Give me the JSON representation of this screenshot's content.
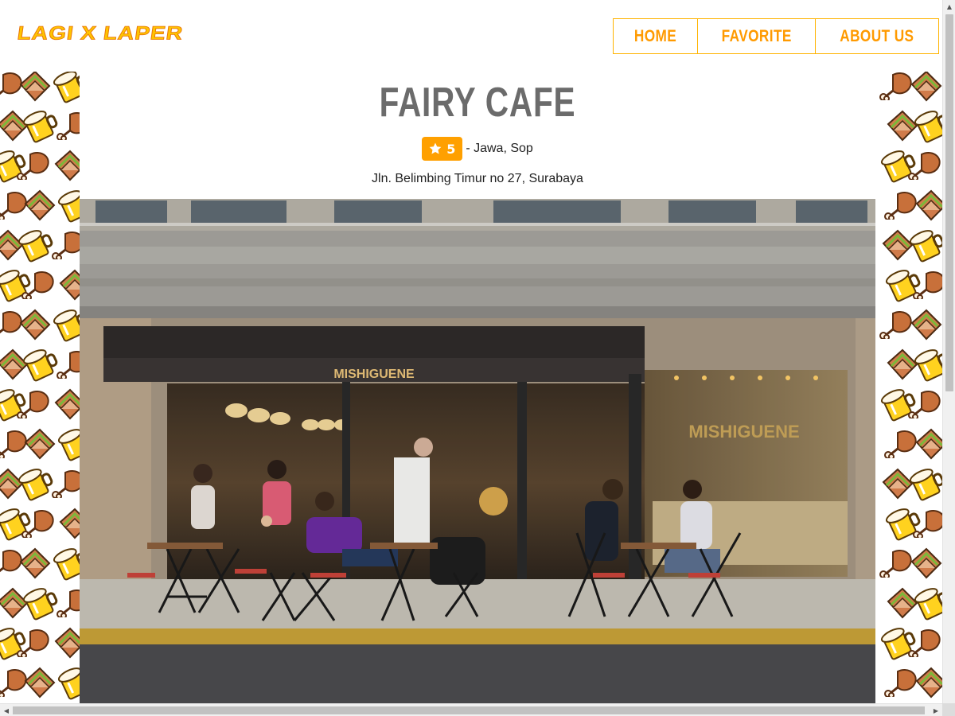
{
  "brand": {
    "logo_text": "LAGI X LAPER"
  },
  "nav": {
    "items": [
      {
        "label": "HOME"
      },
      {
        "label": "FAVORITE"
      },
      {
        "label": "ABOUT US"
      }
    ]
  },
  "restaurant": {
    "name": "FAIRY CAFE",
    "rating": "5",
    "categories": "- Jawa, Sop",
    "address": "Jln. Belimbing Timur no 27, Surabaya",
    "photo_sign_text": "MISHIGUENE"
  },
  "icons": {
    "rating": "star-icon",
    "pattern": [
      "chicken-leg-icon",
      "sandwich-icon",
      "beer-mug-icon"
    ]
  },
  "colors": {
    "accent": "#ffa000",
    "nav_text": "#ff9a00",
    "title_text": "#6b6b6b",
    "logo_fill": "#ffc400"
  }
}
